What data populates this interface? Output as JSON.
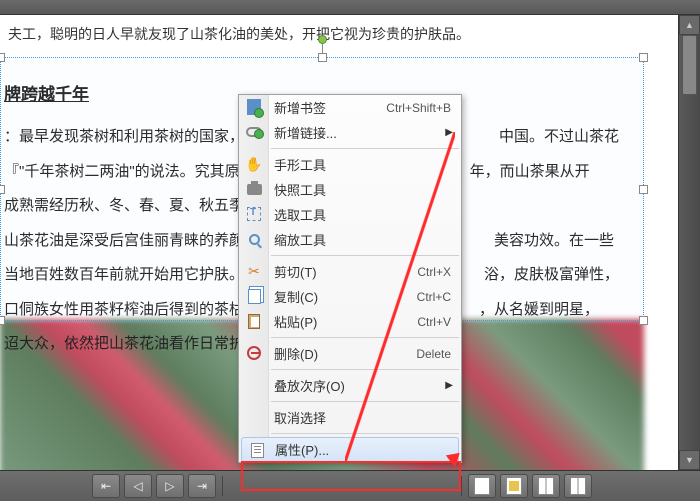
{
  "top_text": "夫工，聪明的日人早就友现了山茶化油的美处，开把它视为珍贵的护肤品。",
  "doc": {
    "title": "牌跨越千年",
    "p1a": "：最早发现茶树和利用茶树的国家，据",
    "p1b": "中国。不过山茶花",
    "p2a": "『\"千年茶树二两油\"的说法。究其原",
    "p2b": "年，而山茶果从开",
    "p3": "成熟需经历秋、冬、春、夏、秋五季，",
    "p4a": "山茶花油是深受后宫佳丽青睐的养颜",
    "p4b": "美容功效。在一些",
    "p5a": "当地百姓数百年前就开始用它护肤。",
    "p5b": "浴，皮肤极富弹性，",
    "p6a": "口侗族女性用茶籽榨油后得到的茶枯洗",
    "p6b": "，从名媛到明星，",
    "p7": "迢大众，依然把山茶花油看作日常护肤"
  },
  "menu": {
    "bookmark": "新增书签",
    "bookmark_sc": "Ctrl+Shift+B",
    "link": "新增链接...",
    "hand": "手形工具",
    "snapshot": "快照工具",
    "select": "选取工具",
    "zoom": "缩放工具",
    "cut": "剪切(T)",
    "cut_sc": "Ctrl+X",
    "copy": "复制(C)",
    "copy_sc": "Ctrl+C",
    "paste": "粘贴(P)",
    "paste_sc": "Ctrl+V",
    "delete": "删除(D)",
    "delete_sc": "Delete",
    "order": "叠放次序(O)",
    "deselect": "取消选择",
    "properties": "属性(P)..."
  }
}
